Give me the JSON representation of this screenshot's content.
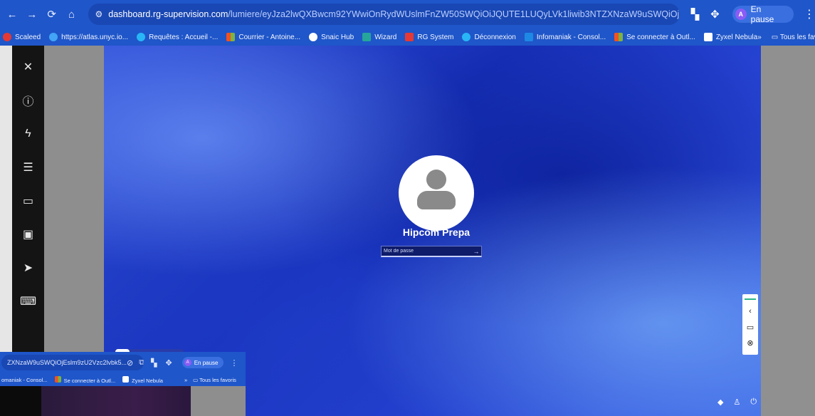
{
  "browser": {
    "url_host": "dashboard.rg-supervision.com",
    "url_path": "/lumiere/eyJza2lwQXBwcm92YWwiOnRydWUslmFnZW50SWQiOiJQUTE1LUQyLVk1liwib3NTZXNzaW9uSWQiOjEslm9zU2Vzc2lvbk5...",
    "profile_initial": "A",
    "profile_status": "En pause",
    "bookmarks": [
      {
        "label": "Scaleed",
        "color": "#e53935"
      },
      {
        "label": "https://atlas.unyc.io...",
        "color": "#42a5f5"
      },
      {
        "label": "Requêtes : Accueil -...",
        "color": "#29b6f6"
      },
      {
        "label": "Courrier - Antoine...",
        "color": "#f4511e"
      },
      {
        "label": "Snaic Hub",
        "color": "#ffffff"
      },
      {
        "label": "Wizard",
        "color": "#26a69a"
      },
      {
        "label": "RG System",
        "color": "#e53935"
      },
      {
        "label": "Déconnexion",
        "color": "#29b6f6"
      },
      {
        "label": "Infomaniak - Consol...",
        "color": "#1e88e5"
      },
      {
        "label": "Se connecter à Outl...",
        "color": "#f4511e"
      },
      {
        "label": "Zyxel Nebula",
        "color": "#ffffff"
      }
    ],
    "bookmarks_more": "»",
    "all_bookmarks": "Tous les favoris"
  },
  "remote": {
    "user_name": "Hipcom Prepa",
    "password_placeholder": "Mot de passe"
  },
  "overlay": {
    "url_fragment": "ZXNzaW9uSWQiOjEslm9zU2Vzc2lvbk5...",
    "profile_status": "En pause",
    "bookmarks": [
      "omaniak - Consol...",
      "Se connecter à Outl...",
      "Zyxel Nebula"
    ],
    "all_bookmarks": "Tous les favoris"
  }
}
